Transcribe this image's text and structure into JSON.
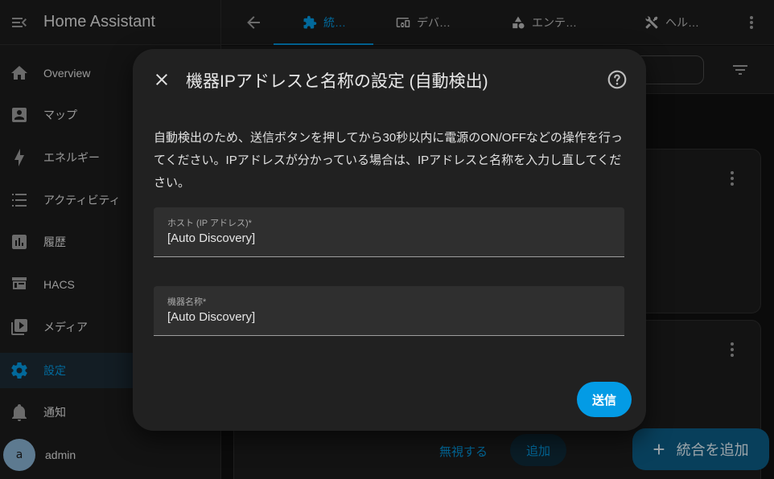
{
  "app": {
    "title": "Home Assistant"
  },
  "sidebar": {
    "items": [
      {
        "label": "Overview",
        "icon": "home-icon"
      },
      {
        "label": "マップ",
        "icon": "map-account-icon"
      },
      {
        "label": "エネルギー",
        "icon": "lightning-icon"
      },
      {
        "label": "アクティビティ",
        "icon": "list-icon"
      },
      {
        "label": "履歴",
        "icon": "chart-box-icon"
      },
      {
        "label": "HACS",
        "icon": "hacs-store-icon"
      },
      {
        "label": "メディア",
        "icon": "play-box-multiple-icon"
      },
      {
        "label": "設定",
        "icon": "gear-icon"
      },
      {
        "label": "通知",
        "icon": "bell-icon"
      }
    ],
    "user": {
      "initial": "a",
      "name": "admin"
    }
  },
  "topbar": {
    "tabs": [
      {
        "label": "統…",
        "icon": "puzzle-icon"
      },
      {
        "label": "デバ…",
        "icon": "devices-icon"
      },
      {
        "label": "エンテ…",
        "icon": "shapes-icon"
      },
      {
        "label": "ヘル…",
        "icon": "tools-icon"
      }
    ]
  },
  "background": {
    "ignore_label": "無視する",
    "add_label": "追加",
    "fab_label": "統合を追加"
  },
  "dialog": {
    "title": "機器IPアドレスと名称の設定 (自動検出)",
    "description": "自動検出のため、送信ボタンを押してから30秒以内に電源のON/OFFなどの操作を行ってください。IPアドレスが分かっている場合は、IPアドレスと名称を入力し直してください。",
    "fields": {
      "host": {
        "label": "ホスト (IP アドレス)*",
        "value": "[Auto Discovery]"
      },
      "name": {
        "label": "機器名称*",
        "value": "[Auto Discovery]"
      }
    },
    "submit_label": "送信"
  },
  "colors": {
    "accent": "#039be5",
    "background": "#111111",
    "surface": "#1c1c1c",
    "dialog": "#212121"
  }
}
